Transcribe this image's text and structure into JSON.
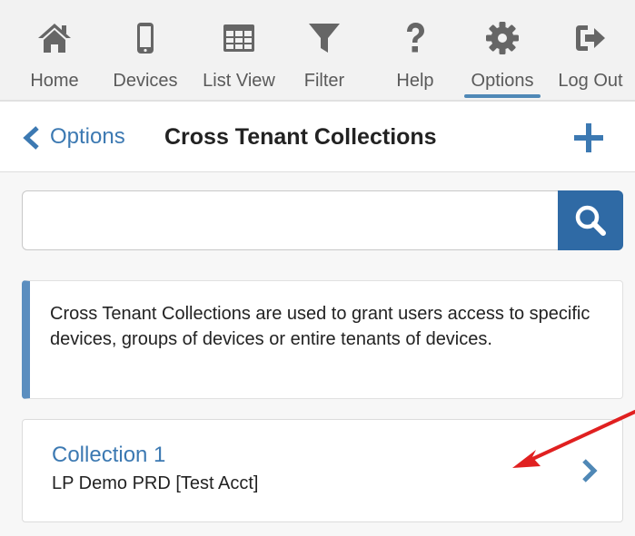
{
  "nav": {
    "items": [
      {
        "label": "Home",
        "icon": "home-icon"
      },
      {
        "label": "Devices",
        "icon": "phone-icon"
      },
      {
        "label": "List View",
        "icon": "grid-icon"
      },
      {
        "label": "Filter",
        "icon": "filter-icon"
      },
      {
        "label": "Help",
        "icon": "question-icon"
      },
      {
        "label": "Options",
        "icon": "gear-icon",
        "active": true
      },
      {
        "label": "Log Out",
        "icon": "logout-icon"
      }
    ]
  },
  "header": {
    "back_label": "Options",
    "title": "Cross Tenant Collections"
  },
  "search": {
    "value": "",
    "placeholder": ""
  },
  "info": {
    "text": "Cross Tenant Collections are used to grant users access to specific devices, groups of devices or entire tenants of devices."
  },
  "collections": [
    {
      "name": "Collection 1",
      "subtitle": "LP Demo PRD [Test Acct]"
    }
  ],
  "colors": {
    "accent": "#3c79b2",
    "search_button": "#2f6aa5",
    "icon_gray": "#666666",
    "annotation": "#e02020"
  }
}
